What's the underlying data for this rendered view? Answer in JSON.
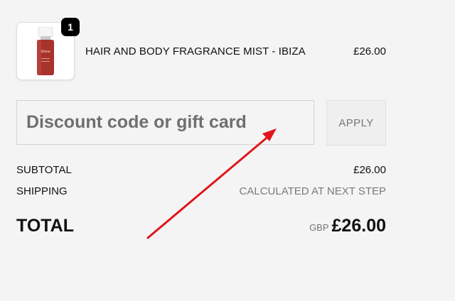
{
  "cart": {
    "items": [
      {
        "quantity": "1",
        "name": "HAIR AND BODY FRAGRANCE MIST - IBIZA",
        "price": "£26.00",
        "thumbnail_icon": "fragrance-bottle-icon",
        "bottle_brand_text": "Gisou"
      }
    ]
  },
  "discount": {
    "placeholder": "Discount code or gift card",
    "value": "",
    "apply_label": "APPLY"
  },
  "summary": {
    "subtotal_label": "SUBTOTAL",
    "subtotal_value": "£26.00",
    "shipping_label": "SHIPPING",
    "shipping_value": "CALCULATED AT NEXT STEP",
    "total_label": "TOTAL",
    "currency_code": "GBP",
    "total_value": "£26.00"
  },
  "colors": {
    "background": "#f4f4f4",
    "badge": "#000000",
    "annotation_arrow": "#e0161b",
    "bottle_liquid": "#a8322c"
  }
}
